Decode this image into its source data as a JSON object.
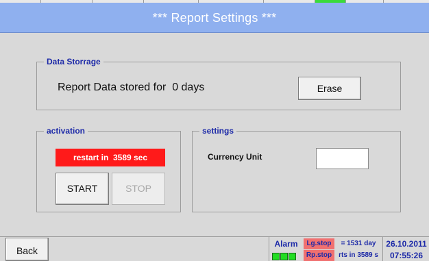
{
  "title": "*** Report Settings ***",
  "data_storage": {
    "legend": "Data Storrage",
    "text": "Report Data stored for  0 days",
    "erase_label": "Erase"
  },
  "activation": {
    "legend": "activation",
    "restart_text": "restart in  3589 sec",
    "start_label": "START",
    "stop_label": "STOP"
  },
  "settings": {
    "legend": "settings",
    "currency_label": "Currency Unit",
    "currency_value": ""
  },
  "status_bar": {
    "back_label": "Back",
    "alarm_label": "Alarm",
    "lg_stop": "Lg.stop",
    "rp_stop": "Rp.stop",
    "lg_info": "= 1531 day",
    "rp_info": "rts in 3589 s",
    "date": "26.10.2011",
    "time": "07:55:26"
  },
  "colors": {
    "title_bar": "#8fb0ef",
    "background": "#d9d9d9",
    "legend_text": "#1d2aa8",
    "restart_bg": "#ff1a1a",
    "stop_badge_bg": "#f07070",
    "alarm_led": "#22dd22"
  }
}
